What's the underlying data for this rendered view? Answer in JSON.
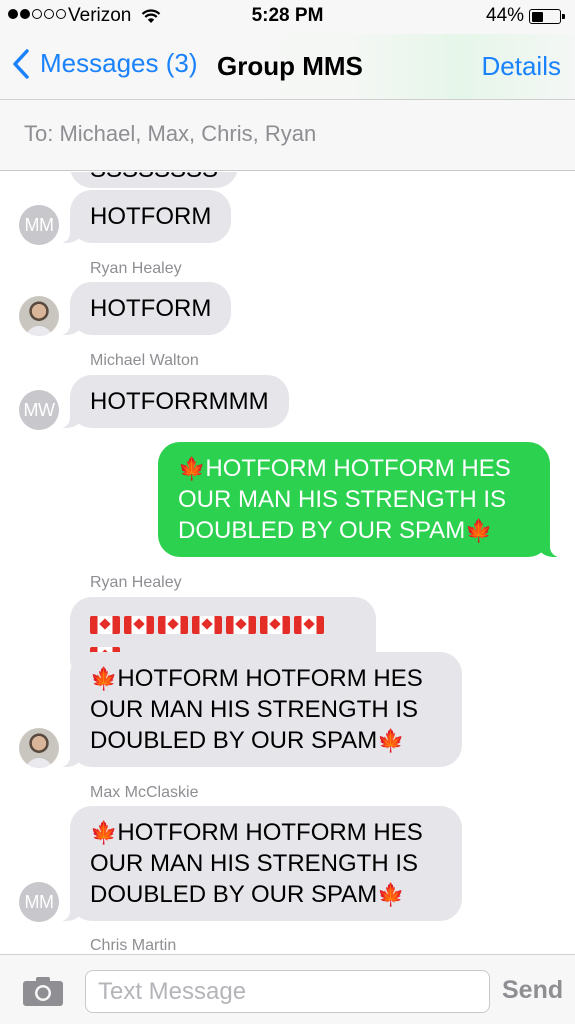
{
  "status_bar": {
    "carrier": "Verizon",
    "time": "5:28 PM",
    "battery": "44%",
    "battery_level": 0.44,
    "signal_bars_filled": 2,
    "signal_bars_total": 5
  },
  "nav": {
    "back_label": "Messages (3)",
    "title": "Group MMS",
    "details_label": "Details"
  },
  "to_field": {
    "text": "To: Michael, Max, Chris, Ryan"
  },
  "messages": {
    "partial_top": "SSSSSSSS",
    "m1": {
      "avatar": "MM",
      "text": "HOTFORM"
    },
    "m2": {
      "sender": "Ryan Healey",
      "text": "HOTFORM"
    },
    "m3": {
      "sender": "Michael Walton",
      "avatar": "MW",
      "text": "HOTFORRMMM"
    },
    "m4": {
      "line1": "HOTFORM HOTFORM HES",
      "line2": "OUR MAN HIS STRENGTH IS",
      "line3": "DOUBLED BY OUR SPAM"
    },
    "m5": {
      "sender": "Ryan Healey",
      "flag_count": 8
    },
    "m6": {
      "line1": "HOTFORM HOTFORM HES",
      "line2": "OUR MAN HIS STRENGTH IS",
      "line3": "DOUBLED BY OUR SPAM"
    },
    "m7": {
      "sender": "Max McClaskie",
      "avatar": "MM",
      "line1": "HOTFORM HOTFORM HES",
      "line2": "OUR MAN HIS STRENGTH IS",
      "line3": "DOUBLED BY OUR SPAM"
    },
    "m8": {
      "sender": "Chris Martin"
    }
  },
  "input_bar": {
    "placeholder": "Text Message",
    "send_label": "Send"
  },
  "colors": {
    "accent": "#1a82fb",
    "outgoing_bubble": "#2bd14f",
    "incoming_bubble": "#e5e5ea"
  },
  "icons": [
    "wifi-icon",
    "chevron-left-icon",
    "camera-icon",
    "maple-leaf-icon",
    "canada-flag-icon",
    "battery-icon"
  ]
}
